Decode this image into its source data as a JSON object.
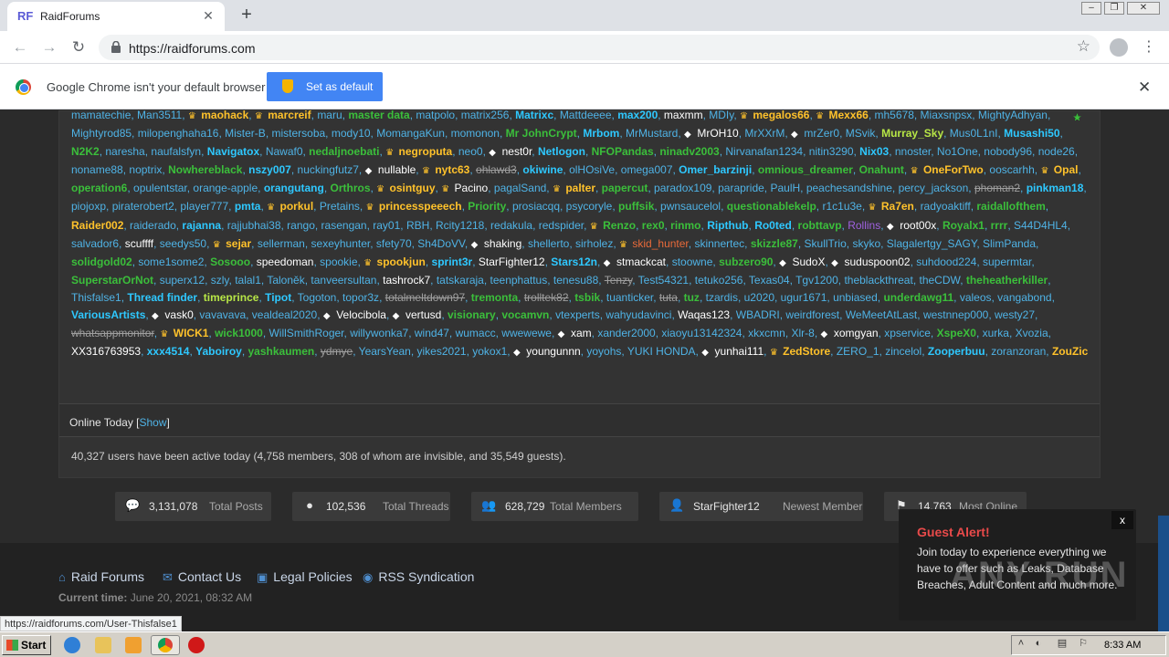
{
  "browser": {
    "tab_title": "RaidForums",
    "tab_favicon": "RF",
    "url": "https://raidforums.com",
    "infobar_text": "Google Chrome isn't your default browser",
    "infobar_button": "Set as default"
  },
  "online_users": [
    {
      "n": "mamatechie",
      "s": "c"
    },
    {
      "n": "Man3511",
      "s": "c"
    },
    {
      "n": "maohack",
      "s": "y",
      "i": "crown"
    },
    {
      "n": "marcreif",
      "s": "y",
      "i": "crown"
    },
    {
      "n": "maru",
      "s": "c"
    },
    {
      "n": "master data",
      "s": "g",
      "i": "star"
    },
    {
      "n": "matpolo",
      "s": "c"
    },
    {
      "n": "matrix256",
      "s": "c"
    },
    {
      "n": "Matrixc",
      "s": "bb"
    },
    {
      "n": "Mattdeeee",
      "s": "c"
    },
    {
      "n": "max200",
      "s": "bb"
    },
    {
      "n": "maxmm",
      "s": "w"
    },
    {
      "n": "MDIy",
      "s": "c"
    },
    {
      "n": "megalos66",
      "s": "y",
      "i": "crown"
    },
    {
      "n": "Mexx66",
      "s": "y",
      "i": "crown"
    },
    {
      "n": "mh5678",
      "s": "c"
    },
    {
      "n": "Miaxsnpsx",
      "s": "c"
    },
    {
      "n": "MightyAdhyan",
      "s": "c"
    },
    {
      "n": "Mightyrod85",
      "s": "c"
    },
    {
      "n": "milopenghaha16",
      "s": "c"
    },
    {
      "n": "Mister-B",
      "s": "c"
    },
    {
      "n": "mistersoba",
      "s": "c"
    },
    {
      "n": "mody10",
      "s": "c"
    },
    {
      "n": "MomangaKun",
      "s": "c"
    },
    {
      "n": "momonon",
      "s": "c"
    },
    {
      "n": "Mr JohnCrypt",
      "s": "g",
      "i": "star"
    },
    {
      "n": "Mrbom",
      "s": "bb"
    },
    {
      "n": "MrMustard",
      "s": "c"
    },
    {
      "n": "MrOH10",
      "s": "w",
      "i": "dia"
    },
    {
      "n": "MrXXrM",
      "s": "c"
    },
    {
      "n": "mrZer0",
      "s": "c",
      "i": "dia"
    },
    {
      "n": "MSvik",
      "s": "c"
    },
    {
      "n": "Murray_Sky",
      "s": "l"
    },
    {
      "n": "Mus0L1nI",
      "s": "c"
    },
    {
      "n": "Musashi50",
      "s": "bb"
    },
    {
      "n": "N2K2",
      "s": "g",
      "i": "star"
    },
    {
      "n": "naresha",
      "s": "c"
    },
    {
      "n": "naufalsfyn",
      "s": "c"
    },
    {
      "n": "Navigatox",
      "s": "bb"
    },
    {
      "n": "Nawaf0",
      "s": "c"
    },
    {
      "n": "nedaljnoebati",
      "s": "g",
      "i": "star"
    },
    {
      "n": "negroputa",
      "s": "y",
      "i": "crown"
    },
    {
      "n": "neo0",
      "s": "c"
    },
    {
      "n": "nest0r",
      "s": "w",
      "i": "dia"
    },
    {
      "n": "Netlogon",
      "s": "bb"
    },
    {
      "n": "NFOPandas",
      "s": "g",
      "i": "star"
    },
    {
      "n": "ninadv2003",
      "s": "g",
      "i": "star"
    },
    {
      "n": "Nirvanafan1234",
      "s": "c"
    },
    {
      "n": "nitin3290",
      "s": "c"
    },
    {
      "n": "Nix03",
      "s": "bb"
    },
    {
      "n": "nnoster",
      "s": "c"
    },
    {
      "n": "No1One",
      "s": "c"
    },
    {
      "n": "nobody96",
      "s": "c"
    },
    {
      "n": "node26",
      "s": "c"
    },
    {
      "n": "noname88",
      "s": "c"
    },
    {
      "n": "noptrix",
      "s": "c"
    },
    {
      "n": "Nowhereblack",
      "s": "g",
      "i": "star"
    },
    {
      "n": "nszy007",
      "s": "bb"
    },
    {
      "n": "nuckingfutz7",
      "s": "c"
    },
    {
      "n": "nullable",
      "s": "w",
      "i": "dia"
    },
    {
      "n": "nytc63",
      "s": "y",
      "i": "crown"
    },
    {
      "n": "ohlawd3",
      "s": "s"
    },
    {
      "n": "okiwine",
      "s": "bb"
    },
    {
      "n": "olHOsiVe",
      "s": "c"
    },
    {
      "n": "omega007",
      "s": "c"
    },
    {
      "n": "Omer_barzinji",
      "s": "bb"
    },
    {
      "n": "omnious_dreamer",
      "s": "g",
      "i": "star"
    },
    {
      "n": "Onahunt",
      "s": "g",
      "i": "star"
    },
    {
      "n": "OneForTwo",
      "s": "y",
      "i": "crown"
    },
    {
      "n": "ooscarhh",
      "s": "c"
    },
    {
      "n": "Opal",
      "s": "y",
      "i": "crown"
    },
    {
      "n": "operation6",
      "s": "g",
      "i": "star"
    },
    {
      "n": "opulentstar",
      "s": "c"
    },
    {
      "n": "orange-apple",
      "s": "c"
    },
    {
      "n": "orangutang",
      "s": "bb"
    },
    {
      "n": "Orthros",
      "s": "g",
      "i": "star"
    },
    {
      "n": "osintguy",
      "s": "y",
      "i": "crown"
    },
    {
      "n": "Pacino",
      "s": "w",
      "i": "crown"
    },
    {
      "n": "pagalSand",
      "s": "c"
    },
    {
      "n": "palter",
      "s": "y",
      "i": "crown"
    },
    {
      "n": "papercut",
      "s": "g",
      "i": "star"
    },
    {
      "n": "paradox109",
      "s": "c"
    },
    {
      "n": "parapride",
      "s": "c"
    },
    {
      "n": "PaulH",
      "s": "c"
    },
    {
      "n": "peachesandshine",
      "s": "c"
    },
    {
      "n": "percy_jackson",
      "s": "c"
    },
    {
      "n": "phoman2",
      "s": "s"
    },
    {
      "n": "pinkman18",
      "s": "bb"
    },
    {
      "n": "piojoxp",
      "s": "c"
    },
    {
      "n": "piraterobert2",
      "s": "c"
    },
    {
      "n": "player777",
      "s": "c"
    },
    {
      "n": "pmta",
      "s": "bb"
    },
    {
      "n": "porkul",
      "s": "y",
      "i": "crown"
    },
    {
      "n": "Pretains",
      "s": "c"
    },
    {
      "n": "princesspeeech",
      "s": "y",
      "i": "crown"
    },
    {
      "n": "Priority",
      "s": "g",
      "i": "star"
    },
    {
      "n": "prosiacqq",
      "s": "c"
    },
    {
      "n": "psycoryle",
      "s": "c"
    },
    {
      "n": "puffsik",
      "s": "g",
      "i": "star"
    },
    {
      "n": "pwnsaucelol",
      "s": "c"
    },
    {
      "n": "questionablekelp",
      "s": "g",
      "i": "star"
    },
    {
      "n": "r1c1u3e",
      "s": "c"
    },
    {
      "n": "Ra7en",
      "s": "y",
      "i": "crown"
    },
    {
      "n": "radyoaktiff",
      "s": "c"
    },
    {
      "n": "raidallofthem",
      "s": "g",
      "i": "star"
    },
    {
      "n": "Raider002",
      "s": "y"
    },
    {
      "n": "raiderado",
      "s": "c"
    },
    {
      "n": "rajanna",
      "s": "bb"
    },
    {
      "n": "rajjubhai38",
      "s": "c"
    },
    {
      "n": "rango",
      "s": "c"
    },
    {
      "n": "rasengan",
      "s": "c"
    },
    {
      "n": "ray01",
      "s": "c"
    },
    {
      "n": "RBH",
      "s": "c"
    },
    {
      "n": "Rcity1218",
      "s": "c"
    },
    {
      "n": "redakula",
      "s": "c"
    },
    {
      "n": "redspider",
      "s": "c"
    },
    {
      "n": "Renzo",
      "s": "g",
      "i": "crown"
    },
    {
      "n": "rex0",
      "s": "g",
      "i": "star"
    },
    {
      "n": "rinmo",
      "s": "g",
      "i": "star"
    },
    {
      "n": "Ripthub",
      "s": "bb"
    },
    {
      "n": "Ro0ted",
      "s": "bb"
    },
    {
      "n": "robttavp",
      "s": "g",
      "i": "star"
    },
    {
      "n": "Rollins",
      "s": "p",
      "i": "star"
    },
    {
      "n": "root00x",
      "s": "w",
      "i": "dia"
    },
    {
      "n": "Royalx1",
      "s": "g",
      "i": "star"
    },
    {
      "n": "rrrr",
      "s": "g",
      "i": "star"
    },
    {
      "n": "S44D4HL4",
      "s": "c"
    },
    {
      "n": "salvador6",
      "s": "c"
    },
    {
      "n": "scuffff",
      "s": "w"
    },
    {
      "n": "seedys50",
      "s": "c"
    },
    {
      "n": "sejar",
      "s": "y",
      "i": "crown"
    },
    {
      "n": "sellerman",
      "s": "c"
    },
    {
      "n": "sexeyhunter",
      "s": "c"
    },
    {
      "n": "sfety70",
      "s": "c"
    },
    {
      "n": "Sh4DoVV",
      "s": "c"
    },
    {
      "n": "shaking",
      "s": "w",
      "i": "dia"
    },
    {
      "n": "shellerto",
      "s": "c"
    },
    {
      "n": "sirholez",
      "s": "c"
    },
    {
      "n": "skid_hunter",
      "s": "o",
      "i": "crown"
    },
    {
      "n": "skinnertec",
      "s": "c"
    },
    {
      "n": "skizzle87",
      "s": "g",
      "i": "star"
    },
    {
      "n": "SkullTrio",
      "s": "c"
    },
    {
      "n": "skyko",
      "s": "c"
    },
    {
      "n": "Slagalertgy_SAGY",
      "s": "c"
    },
    {
      "n": "SlimPanda",
      "s": "c"
    },
    {
      "n": "solidgold02",
      "s": "g",
      "i": "star"
    },
    {
      "n": "some1some2",
      "s": "c"
    },
    {
      "n": "Sosooo",
      "s": "g",
      "i": "star"
    },
    {
      "n": "speedoman",
      "s": "w"
    },
    {
      "n": "spookie",
      "s": "c"
    },
    {
      "n": "spookjun",
      "s": "y",
      "i": "crown"
    },
    {
      "n": "sprint3r",
      "s": "bb"
    },
    {
      "n": "StarFighter12",
      "s": "w"
    },
    {
      "n": "Stars12n",
      "s": "bb"
    },
    {
      "n": "stmackcat",
      "s": "w",
      "i": "dia"
    },
    {
      "n": "stoowne",
      "s": "c"
    },
    {
      "n": "subzero90",
      "s": "g",
      "i": "star"
    },
    {
      "n": "SudoX",
      "s": "w",
      "i": "dia"
    },
    {
      "n": "suduspoon02",
      "s": "w",
      "i": "dia"
    },
    {
      "n": "suhdood224",
      "s": "c"
    },
    {
      "n": "supermtar",
      "s": "c"
    },
    {
      "n": "SuperstarOrNot",
      "s": "g",
      "i": "star"
    },
    {
      "n": "superx12",
      "s": "c"
    },
    {
      "n": "szly",
      "s": "c"
    },
    {
      "n": "talal1",
      "s": "c"
    },
    {
      "n": "Taloněk",
      "s": "c"
    },
    {
      "n": "tanveersultan",
      "s": "c"
    },
    {
      "n": "tashrock7",
      "s": "w"
    },
    {
      "n": "tatskaraja",
      "s": "c"
    },
    {
      "n": "teenphattus",
      "s": "c"
    },
    {
      "n": "tenesu88",
      "s": "c"
    },
    {
      "n": "Tenzy",
      "s": "s"
    },
    {
      "n": "Test54321",
      "s": "c"
    },
    {
      "n": "tetuko256",
      "s": "c"
    },
    {
      "n": "Texas04",
      "s": "c"
    },
    {
      "n": "Tgv1200",
      "s": "c"
    },
    {
      "n": "theblackthreat",
      "s": "c"
    },
    {
      "n": "theCDW",
      "s": "c"
    },
    {
      "n": "theheatherkiller",
      "s": "g",
      "i": "star"
    },
    {
      "n": "Thisfalse1",
      "s": "c"
    },
    {
      "n": "Thread finder",
      "s": "bb"
    },
    {
      "n": "timeprince",
      "s": "l"
    },
    {
      "n": "Tipot",
      "s": "bb"
    },
    {
      "n": "Togoton",
      "s": "c"
    },
    {
      "n": "topor3z",
      "s": "c"
    },
    {
      "n": "totalmeltdown97",
      "s": "s"
    },
    {
      "n": "tremonta",
      "s": "g",
      "i": "star"
    },
    {
      "n": "trolltek82",
      "s": "s"
    },
    {
      "n": "tsbik",
      "s": "g",
      "i": "star"
    },
    {
      "n": "tuanticker",
      "s": "c"
    },
    {
      "n": "tuta",
      "s": "s"
    },
    {
      "n": "tuz",
      "s": "g",
      "i": "star"
    },
    {
      "n": "tzardis",
      "s": "c"
    },
    {
      "n": "u2020",
      "s": "c"
    },
    {
      "n": "ugur1671",
      "s": "c"
    },
    {
      "n": "unbiased",
      "s": "c"
    },
    {
      "n": "underdawg11",
      "s": "g",
      "i": "star"
    },
    {
      "n": "valeos",
      "s": "c"
    },
    {
      "n": "vangabond",
      "s": "c"
    },
    {
      "n": "VariousArtists",
      "s": "bb"
    },
    {
      "n": "vask0",
      "s": "w",
      "i": "dia"
    },
    {
      "n": "vavavava",
      "s": "c"
    },
    {
      "n": "vealdeal2020",
      "s": "c"
    },
    {
      "n": "Velocibola",
      "s": "w",
      "i": "dia"
    },
    {
      "n": "vertusd",
      "s": "w",
      "i": "dia"
    },
    {
      "n": "visionary",
      "s": "g",
      "i": "star"
    },
    {
      "n": "vocamvn",
      "s": "g",
      "i": "star"
    },
    {
      "n": "vtexperts",
      "s": "c"
    },
    {
      "n": "wahyudavinci",
      "s": "c"
    },
    {
      "n": "Waqas123",
      "s": "w"
    },
    {
      "n": "WBADRI",
      "s": "c"
    },
    {
      "n": "weirdforest",
      "s": "c"
    },
    {
      "n": "WeMeetAtLast",
      "s": "c"
    },
    {
      "n": "westnnep000",
      "s": "c"
    },
    {
      "n": "westy27",
      "s": "c"
    },
    {
      "n": "whatsappmonitor",
      "s": "s"
    },
    {
      "n": "WICK1",
      "s": "y",
      "i": "crown"
    },
    {
      "n": "wick1000",
      "s": "g",
      "i": "star"
    },
    {
      "n": "WillSmithRoger",
      "s": "c"
    },
    {
      "n": "willywonka7",
      "s": "c"
    },
    {
      "n": "wind47",
      "s": "c"
    },
    {
      "n": "wumacc",
      "s": "c"
    },
    {
      "n": "wwewewe",
      "s": "c"
    },
    {
      "n": "xam",
      "s": "w",
      "i": "dia"
    },
    {
      "n": "xander2000",
      "s": "c"
    },
    {
      "n": "xiaoyu13142324",
      "s": "c"
    },
    {
      "n": "xkxcmn",
      "s": "c"
    },
    {
      "n": "Xlr-8",
      "s": "c"
    },
    {
      "n": "xomgyan",
      "s": "w",
      "i": "dia"
    },
    {
      "n": "xpservice",
      "s": "c"
    },
    {
      "n": "XspeX0",
      "s": "g",
      "i": "star"
    },
    {
      "n": "xurka",
      "s": "c"
    },
    {
      "n": "Xvozia",
      "s": "c"
    },
    {
      "n": "XX316763953",
      "s": "w"
    },
    {
      "n": "xxx4514",
      "s": "bb"
    },
    {
      "n": "Yaboiroy",
      "s": "bb"
    },
    {
      "n": "yashkaumen",
      "s": "g",
      "i": "star"
    },
    {
      "n": "ydmye",
      "s": "s"
    },
    {
      "n": "YearsYean",
      "s": "c"
    },
    {
      "n": "yikes2021",
      "s": "c"
    },
    {
      "n": "yokox1",
      "s": "c"
    },
    {
      "n": "youngunnn",
      "s": "w",
      "i": "dia"
    },
    {
      "n": "yoyohs",
      "s": "c"
    },
    {
      "n": "YUKI HONDA",
      "s": "c"
    },
    {
      "n": "yunhai111",
      "s": "w",
      "i": "dia"
    },
    {
      "n": "ZedStore",
      "s": "y",
      "i": "crown"
    },
    {
      "n": "ZERO_1",
      "s": "c"
    },
    {
      "n": "zincelol",
      "s": "c"
    },
    {
      "n": "Zooperbuu",
      "s": "bb"
    },
    {
      "n": "zoranzoran",
      "s": "c"
    },
    {
      "n": "ZouZic",
      "s": "y",
      "i": "star"
    }
  ],
  "online_today": {
    "title": "Online Today",
    "show_link": "Show",
    "summary": "40,327 users have been active today (4,758 members, 308 of whom are invisible, and 35,549 guests)."
  },
  "stats": [
    {
      "icon": "comments-icon",
      "glyph": "💬",
      "value": "3,131,078",
      "label": "Total Posts"
    },
    {
      "icon": "comment-icon",
      "glyph": "●",
      "value": "102,536",
      "label": "Total Threads"
    },
    {
      "icon": "users-icon",
      "glyph": "👥",
      "value": "628,729",
      "label": "Total Members"
    },
    {
      "icon": "user-plus-icon",
      "glyph": "👤",
      "value": "StarFighter12",
      "label": "Newest Member"
    },
    {
      "icon": "flag-icon",
      "glyph": "⚑",
      "value": "14,763",
      "label": "Most Online"
    }
  ],
  "footer": {
    "links": [
      {
        "icon": "home-icon",
        "glyph": "⌂",
        "label": "Raid Forums"
      },
      {
        "icon": "envelope-icon",
        "glyph": "✉",
        "label": "Contact Us"
      },
      {
        "icon": "briefcase-icon",
        "glyph": "▣",
        "label": "Legal Policies"
      },
      {
        "icon": "rss-icon",
        "glyph": "◉",
        "label": "RSS Syndication"
      }
    ],
    "current_time_label": "Current time:",
    "current_time_value": "June 20, 2021, 08:32 AM"
  },
  "status_bar_url": "https://raidforums.com/User-Thisfalse1",
  "guest_alert": {
    "close": "x",
    "title": "Guest Alert!",
    "text": "Join today to experience everything we have to offer such as Leaks, Database Breaches, Adult Content and much more."
  },
  "watermark": "ANY RUN",
  "taskbar": {
    "start_label": "Start",
    "clock": "8:33 AM"
  },
  "colors": {
    "page_bg": "#2b2b2b",
    "link_blue": "#4fb3e6",
    "group_green": "#3bbf3b",
    "group_gold": "#ffc22b",
    "alert_red": "#e84a4a",
    "chrome_button_blue": "#4285f4"
  }
}
